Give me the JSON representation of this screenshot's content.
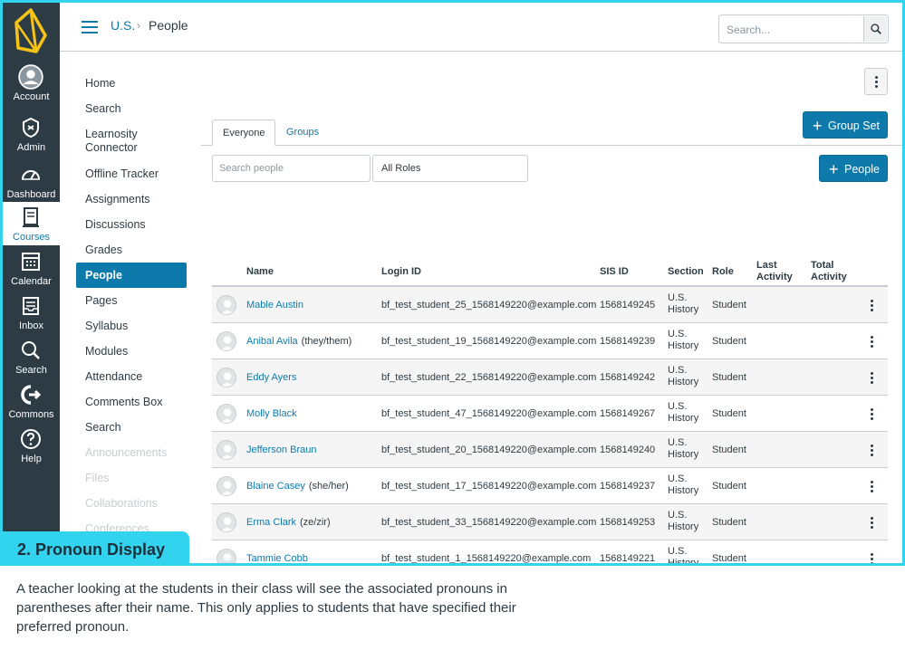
{
  "global_nav": {
    "items": [
      {
        "label": "Account",
        "icon": "account-icon"
      },
      {
        "label": "Admin",
        "icon": "admin-icon"
      },
      {
        "label": "Dashboard",
        "icon": "dashboard-icon"
      },
      {
        "label": "Courses",
        "icon": "courses-icon"
      },
      {
        "label": "Calendar",
        "icon": "calendar-icon"
      },
      {
        "label": "Inbox",
        "icon": "inbox-icon"
      },
      {
        "label": "Search",
        "icon": "search-icon"
      },
      {
        "label": "Commons",
        "icon": "commons-icon"
      },
      {
        "label": "Help",
        "icon": "help-icon"
      }
    ]
  },
  "header": {
    "course": "U.S.",
    "separator": "›",
    "page": "People",
    "search_placeholder": "Search..."
  },
  "course_nav": {
    "items": [
      {
        "label": "Home"
      },
      {
        "label": "Search"
      },
      {
        "label": "Learnosity Connector"
      },
      {
        "label": "Offline Tracker"
      },
      {
        "label": "Assignments"
      },
      {
        "label": "Discussions"
      },
      {
        "label": "Grades"
      },
      {
        "label": "People"
      },
      {
        "label": "Pages"
      },
      {
        "label": "Syllabus"
      },
      {
        "label": "Modules"
      },
      {
        "label": "Attendance"
      },
      {
        "label": "Comments Box"
      },
      {
        "label": "Search"
      },
      {
        "label": "Announcements"
      },
      {
        "label": "Files"
      },
      {
        "label": "Collaborations"
      },
      {
        "label": "Conferences"
      }
    ]
  },
  "main": {
    "tabs": [
      {
        "label": "Everyone"
      },
      {
        "label": "Groups"
      }
    ],
    "group_set_button": "Group Set",
    "people_button": "People",
    "search_people_placeholder": "Search people",
    "roles_select": "All Roles",
    "columns": {
      "name": "Name",
      "login_id": "Login ID",
      "sis_id": "SIS ID",
      "section": "Section",
      "role": "Role",
      "last_activity": [
        "Last",
        "Activity"
      ],
      "total_activity": [
        "Total",
        "Activity"
      ]
    },
    "rows": [
      {
        "name": "Mable Austin",
        "pronoun": "",
        "login": "bf_test_student_25_1568149220@example.com",
        "sis": "1568149245",
        "section": [
          "U.S.",
          "History"
        ],
        "role": "Student"
      },
      {
        "name": "Anibal Avila",
        "pronoun": "(they/them)",
        "login": "bf_test_student_19_1568149220@example.com",
        "sis": "1568149239",
        "section": [
          "U.S.",
          "History"
        ],
        "role": "Student"
      },
      {
        "name": "Eddy Ayers",
        "pronoun": "",
        "login": "bf_test_student_22_1568149220@example.com",
        "sis": "1568149242",
        "section": [
          "U.S.",
          "History"
        ],
        "role": "Student"
      },
      {
        "name": "Molly Black",
        "pronoun": "",
        "login": "bf_test_student_47_1568149220@example.com",
        "sis": "1568149267",
        "section": [
          "U.S.",
          "History"
        ],
        "role": "Student"
      },
      {
        "name": "Jefferson Braun",
        "pronoun": "",
        "login": "bf_test_student_20_1568149220@example.com",
        "sis": "1568149240",
        "section": [
          "U.S.",
          "History"
        ],
        "role": "Student"
      },
      {
        "name": "Blaine Casey",
        "pronoun": "(she/her)",
        "login": "bf_test_student_17_1568149220@example.com",
        "sis": "1568149237",
        "section": [
          "U.S.",
          "History"
        ],
        "role": "Student"
      },
      {
        "name": "Erma Clark",
        "pronoun": "(ze/zir)",
        "login": "bf_test_student_33_1568149220@example.com",
        "sis": "1568149253",
        "section": [
          "U.S.",
          "History"
        ],
        "role": "Student"
      },
      {
        "name": "Tammie Cobb",
        "pronoun": "",
        "login": "bf_test_student_1_1568149220@example.com",
        "sis": "1568149221",
        "section": [
          "U.S.",
          "History"
        ],
        "role": "Student"
      }
    ]
  },
  "callout": {
    "label": "2.  Pronoun Display"
  },
  "caption": "A teacher looking at the students in their class will see the associated pronouns in parentheses after their name. This only applies to students that have specified their preferred pronoun.",
  "colors": {
    "accent": "#0e7aac",
    "nav_bg": "#2d3b45",
    "callout": "#32d3ee",
    "logo": "#f7c317"
  }
}
